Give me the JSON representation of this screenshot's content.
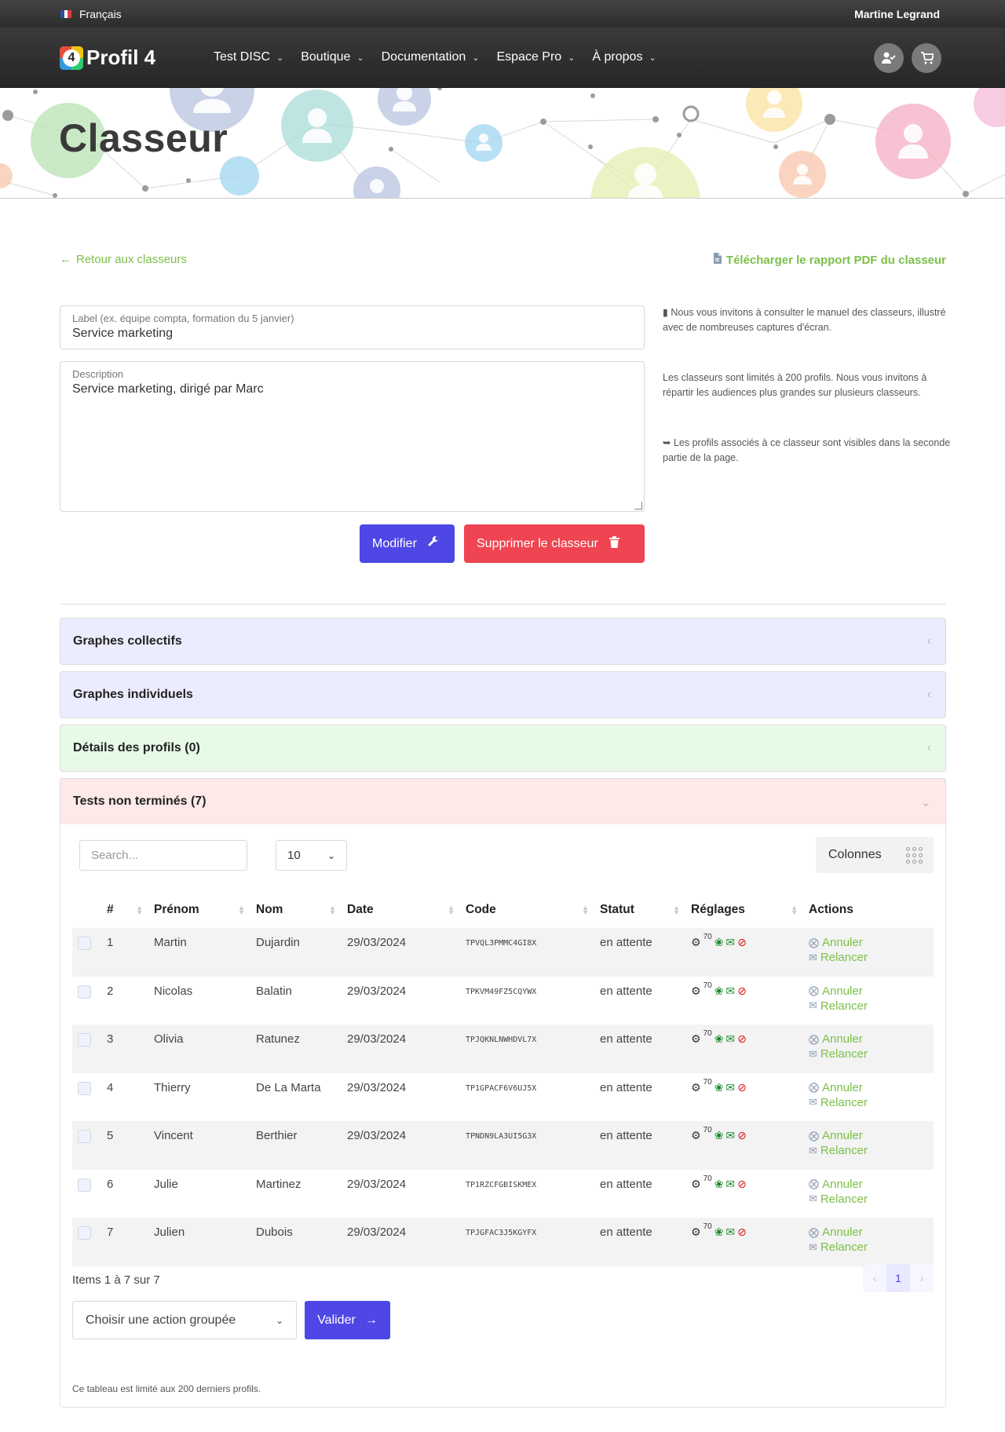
{
  "topbar": {
    "language": "Français",
    "user": "Martine Legrand"
  },
  "nav": {
    "logo_text": "Profil 4",
    "logo_number": "4",
    "menu": [
      "Test DISC",
      "Boutique",
      "Documentation",
      "Espace Pro",
      "À propos"
    ]
  },
  "hero": {
    "title": "Classeur"
  },
  "links": {
    "back": "Retour aux classeurs",
    "pdf": "Télécharger le rapport PDF du classeur"
  },
  "form": {
    "label_caption": "Label (ex. équipe compta, formation du 5 janvier)",
    "label_value": "Service marketing",
    "desc_caption": "Description",
    "desc_value": "Service marketing, dirigé par Marc"
  },
  "help": {
    "manual": "Nous vous invitons à consulter le manuel des classeurs, illustré avec de nombreuses captures d'écran.",
    "limit": "Les classeurs sont limités à 200 profils. Nous vous invitons à répartir les audiences plus grandes sur plusieurs classeurs.",
    "profiles": "Les profils associés à ce classeur sont visibles dans la seconde partie de la page."
  },
  "buttons": {
    "modify": "Modifier",
    "delete": "Supprimer le classeur"
  },
  "accordions": {
    "collective": "Graphes collectifs",
    "individual": "Graphes individuels",
    "details": "Détails des profils (0)",
    "unfinished": "Tests non terminés (7)"
  },
  "table_controls": {
    "search_placeholder": "Search...",
    "page_size": "10",
    "columns": "Colonnes"
  },
  "table": {
    "headers": [
      "#",
      "Prénom",
      "Nom",
      "Date",
      "Code",
      "Statut",
      "Réglages",
      "Actions"
    ],
    "settings_value": "70",
    "action_cancel": "Annuler",
    "action_remind": "Relancer",
    "rows": [
      {
        "num": "1",
        "first": "Martin",
        "last": "Dujardin",
        "date": "29/03/2024",
        "code": "TPVQL3PMMC4GI8X",
        "status": "en attente"
      },
      {
        "num": "2",
        "first": "Nicolas",
        "last": "Balatin",
        "date": "29/03/2024",
        "code": "TPKVM49FZ5CQYWX",
        "status": "en attente"
      },
      {
        "num": "3",
        "first": "Olivia",
        "last": "Ratunez",
        "date": "29/03/2024",
        "code": "TPJQKNLNWHDVL7X",
        "status": "en attente"
      },
      {
        "num": "4",
        "first": "Thierry",
        "last": "De La Marta",
        "date": "29/03/2024",
        "code": "TP1GPACF6V6UJ5X",
        "status": "en attente"
      },
      {
        "num": "5",
        "first": "Vincent",
        "last": "Berthier",
        "date": "29/03/2024",
        "code": "TPNDN9LA3UI5G3X",
        "status": "en attente"
      },
      {
        "num": "6",
        "first": "Julie",
        "last": "Martinez",
        "date": "29/03/2024",
        "code": "TP1RZCFGBISKMEX",
        "status": "en attente"
      },
      {
        "num": "7",
        "first": "Julien",
        "last": "Dubois",
        "date": "29/03/2024",
        "code": "TPJGFAC3J5KGYFX",
        "status": "en attente"
      }
    ]
  },
  "pagination": {
    "info": "Items 1 à 7 sur 7",
    "current": "1",
    "prev": "‹",
    "next": "›"
  },
  "bulk": {
    "placeholder": "Choisir une action groupée",
    "validate": "Valider"
  },
  "footnote": "Ce tableau est limité aux 200 derniers profils.",
  "colors": {
    "primary": "#4e46e5",
    "danger": "#ef4451",
    "green_link": "#7cbf4a"
  },
  "icons": {
    "back": "arrow-left-icon",
    "pdf": "file-pdf-icon",
    "manual": "book-icon",
    "info": "arrow-circle-down-icon",
    "modify": "wrench-icon",
    "delete": "trash-icon",
    "user": "user-check-icon",
    "cart": "cart-icon",
    "settings": "gear-icon",
    "growth": "sprout-icon",
    "mail": "envelope-icon",
    "hidden": "eye-slash-icon",
    "cancel": "circle-x-icon",
    "remind": "envelope-icon",
    "validate": "arrow-right-icon"
  }
}
